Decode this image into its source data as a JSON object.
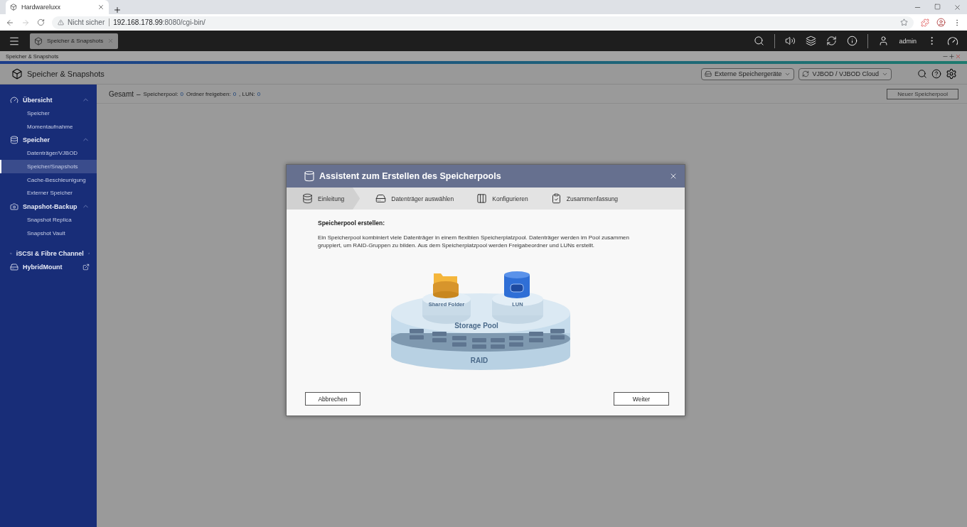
{
  "browser": {
    "tab_title": "Hardwareluxx",
    "address_warning": "Nicht sicher",
    "url_host": "192.168.178.99",
    "url_rest": ":8080/cgi-bin/"
  },
  "topbar": {
    "app_tab": "Speicher & Snapshots",
    "user": "admin"
  },
  "app_window": {
    "title": "Speicher & Snapshots"
  },
  "app_header": {
    "title": "Speicher & Snapshots",
    "dropdowns": [
      "Externe Speichergeräte",
      "VJBOD / VJBOD Cloud"
    ]
  },
  "summary": {
    "label": "Gesamt",
    "dash": "–",
    "items": [
      {
        "label": "Speicherpool:",
        "value": "0"
      },
      {
        "label": "Ordner freigeben:",
        "value": "0"
      },
      {
        "label": ", LUN:",
        "value": "0"
      }
    ],
    "button": "Neuer Speicherpool"
  },
  "sidebar": [
    {
      "kind": "group",
      "label": "Übersicht",
      "expanded": true,
      "children": [
        {
          "label": "Speicher",
          "selected": false
        },
        {
          "label": "Momentaufnahme",
          "selected": false
        }
      ]
    },
    {
      "kind": "group",
      "label": "Speicher",
      "expanded": true,
      "children": [
        {
          "label": "Datenträger/VJBOD",
          "selected": false
        },
        {
          "label": "Speicher/Snapshots",
          "selected": true
        },
        {
          "label": "Cache-Beschleunigung",
          "selected": false
        },
        {
          "label": "Externer Speicher",
          "selected": false
        }
      ]
    },
    {
      "kind": "group",
      "label": "Snapshot-Backup",
      "expanded": true,
      "children": [
        {
          "label": "Snapshot Replica",
          "selected": false
        },
        {
          "label": "Snapshot Vault",
          "selected": false
        }
      ]
    },
    {
      "kind": "link",
      "label": "iSCSI & Fibre Channel"
    },
    {
      "kind": "link",
      "label": "HybridMount"
    }
  ],
  "dialog": {
    "title": "Assistent zum Erstellen des Speicherpools",
    "steps": [
      {
        "label": "Einleitung",
        "selected": true
      },
      {
        "label": "Datenträger auswählen",
        "selected": false
      },
      {
        "label": "Konfigurieren",
        "selected": false
      },
      {
        "label": "Zusammenfassung",
        "selected": false
      }
    ],
    "heading": "Speicherpool erstellen:",
    "description": "Ein Speicherpool kombiniert viele Datenträger in einem flexiblen Speicherplatzpool. Datenträger werden im Pool zusammen gruppiert, um RAID-Gruppen zu bilden. Aus dem Speicherplatzpool werden Freigabeordner und LUNs erstellt.",
    "illustration_labels": {
      "folder": "Shared Folder",
      "lun": "LUN",
      "pool": "Storage Pool",
      "raid": "RAID"
    },
    "buttons": {
      "cancel": "Abbrechen",
      "next": "Weiter"
    }
  }
}
